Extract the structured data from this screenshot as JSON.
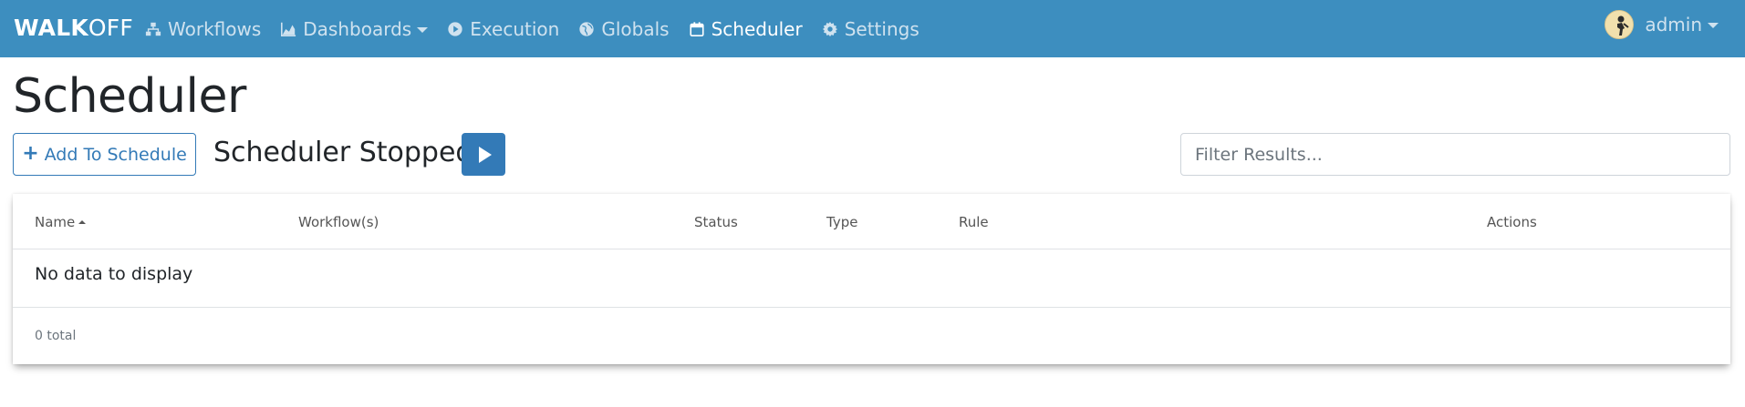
{
  "navbar": {
    "brand_bold": "WALK",
    "brand_light": "OFF",
    "items": [
      {
        "label": "Workflows",
        "icon": "sitemap-icon"
      },
      {
        "label": "Dashboards",
        "icon": "area-chart-icon",
        "dropdown": true
      },
      {
        "label": "Execution",
        "icon": "play-circle-icon"
      },
      {
        "label": "Globals",
        "icon": "globe-icon"
      },
      {
        "label": "Scheduler",
        "icon": "calendar-icon",
        "active": true
      },
      {
        "label": "Settings",
        "icon": "gear-icon"
      }
    ],
    "user": "admin",
    "colors": {
      "bar": "#3d8ebf",
      "inactive_text": "#cfe2ef",
      "active_text": "#ffffff"
    }
  },
  "page": {
    "title": "Scheduler"
  },
  "toolbar": {
    "add_label": "Add To Schedule",
    "add_icon": "plus-icon",
    "status": "Scheduler Stopped",
    "start_icon": "play-icon",
    "filter_placeholder": "Filter Results...",
    "filter_value": ""
  },
  "table": {
    "columns": [
      "Name",
      "Workflow(s)",
      "Status",
      "Type",
      "Rule",
      "Actions"
    ],
    "sorted_by": "Name",
    "empty_message": "No data to display",
    "total": "0 total"
  },
  "colors": {
    "primary": "#337ab7"
  }
}
